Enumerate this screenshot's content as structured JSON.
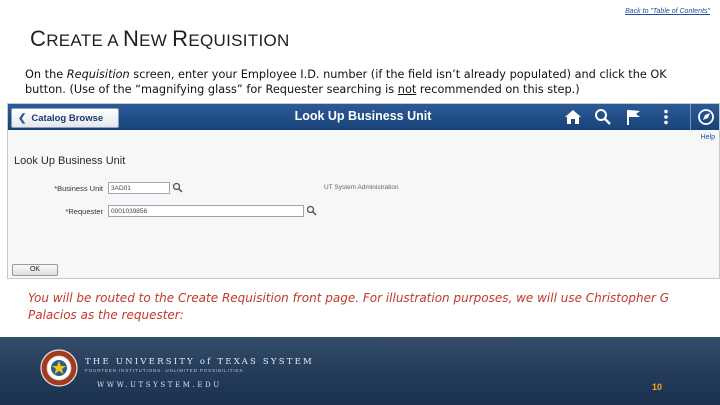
{
  "header": {
    "back_link": "Back to \"Table of Contents\"",
    "title_first_cap": "C",
    "title_word1": "reate a ",
    "title_n": "N",
    "title_word2": "ew ",
    "title_r": "R",
    "title_word3": "equisition"
  },
  "intro": {
    "part1": "On the ",
    "italic": "Requisition",
    "part2": " screen, enter your Employee I.D. number (if the field isn’t already populated) and click the OK button.  (Use of the “magnifying glass” for Requester searching is ",
    "underlined": "not",
    "part3": " recommended on this step.)"
  },
  "screenshot": {
    "catalog_button": "Catalog Browse",
    "header_title": "Look Up Business Unit",
    "help": "Help",
    "icons": [
      "home-icon",
      "search-icon",
      "flag-icon",
      "menu-icon",
      "navbar-icon"
    ],
    "page_title": "Look Up Business Unit",
    "business_unit_label": "*Business Unit",
    "business_unit_value": "3AD01",
    "business_unit_desc": "UT System Administration",
    "requester_label": "*Requester",
    "requester_value": "0001039856",
    "ok_button": "OK"
  },
  "note": "You will be routed to the Create Requisition front page. For illustration purposes, we will use Christopher G Palacios as the requester:",
  "footer": {
    "university": "THE UNIVERSITY of TEXAS SYSTEM",
    "tagline": "FOURTEEN INSTITUTIONS. UNLIMITED POSSIBILITIES.",
    "website": "WWW.UTSYSTEM.EDU",
    "page_number": "10",
    "colors": {
      "navy": "#223a58",
      "accent": "#f5a623"
    }
  }
}
